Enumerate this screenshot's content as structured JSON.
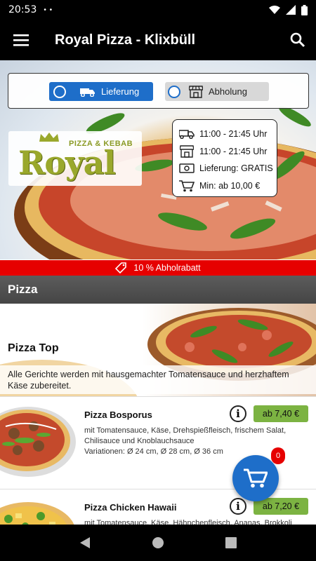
{
  "status": {
    "time": "20:53",
    "dots": "• •"
  },
  "appbar": {
    "title": "Royal Pizza - Klixbüll"
  },
  "order_mode": {
    "delivery_label": "Lieferung",
    "pickup_label": "Abholung",
    "selected": "delivery"
  },
  "logo": {
    "subtitle": "PIZZA & KEBAB",
    "name": "Royal"
  },
  "info": {
    "delivery_hours": "11:00 - 21:45 Uhr",
    "pickup_hours": "11:00 - 21:45 Uhr",
    "delivery_fee": "Lieferung: GRATIS",
    "min_order": "Min: ab 10,00 €"
  },
  "promo": {
    "text": "10 % Abholrabatt"
  },
  "category": {
    "header": "Pizza",
    "title": "Pizza Top",
    "description": "Alle Gerichte werden mit hausgemachter Tomatensauce und herzhaftem Käse zubereitet."
  },
  "products": [
    {
      "name": "Pizza Bosporus",
      "price": "ab 7,40 €",
      "description": "mit Tomatensauce, Käse, Drehspießfleisch, frischem Salat, Chilisauce und Knoblauchsauce",
      "variations": "Variationen: Ø 24 cm, Ø 28 cm, Ø 36 cm"
    },
    {
      "name": "Pizza Chicken Hawaii",
      "price": "ab 7,20 €",
      "description": "mit Tomatensauce, Käse, Hähnchenfleisch, Ananas, Brokkoli"
    }
  ],
  "cart": {
    "count": "0"
  },
  "colors": {
    "accent": "#1e6ec9",
    "promo": "#e60000",
    "price": "#7cb342"
  }
}
